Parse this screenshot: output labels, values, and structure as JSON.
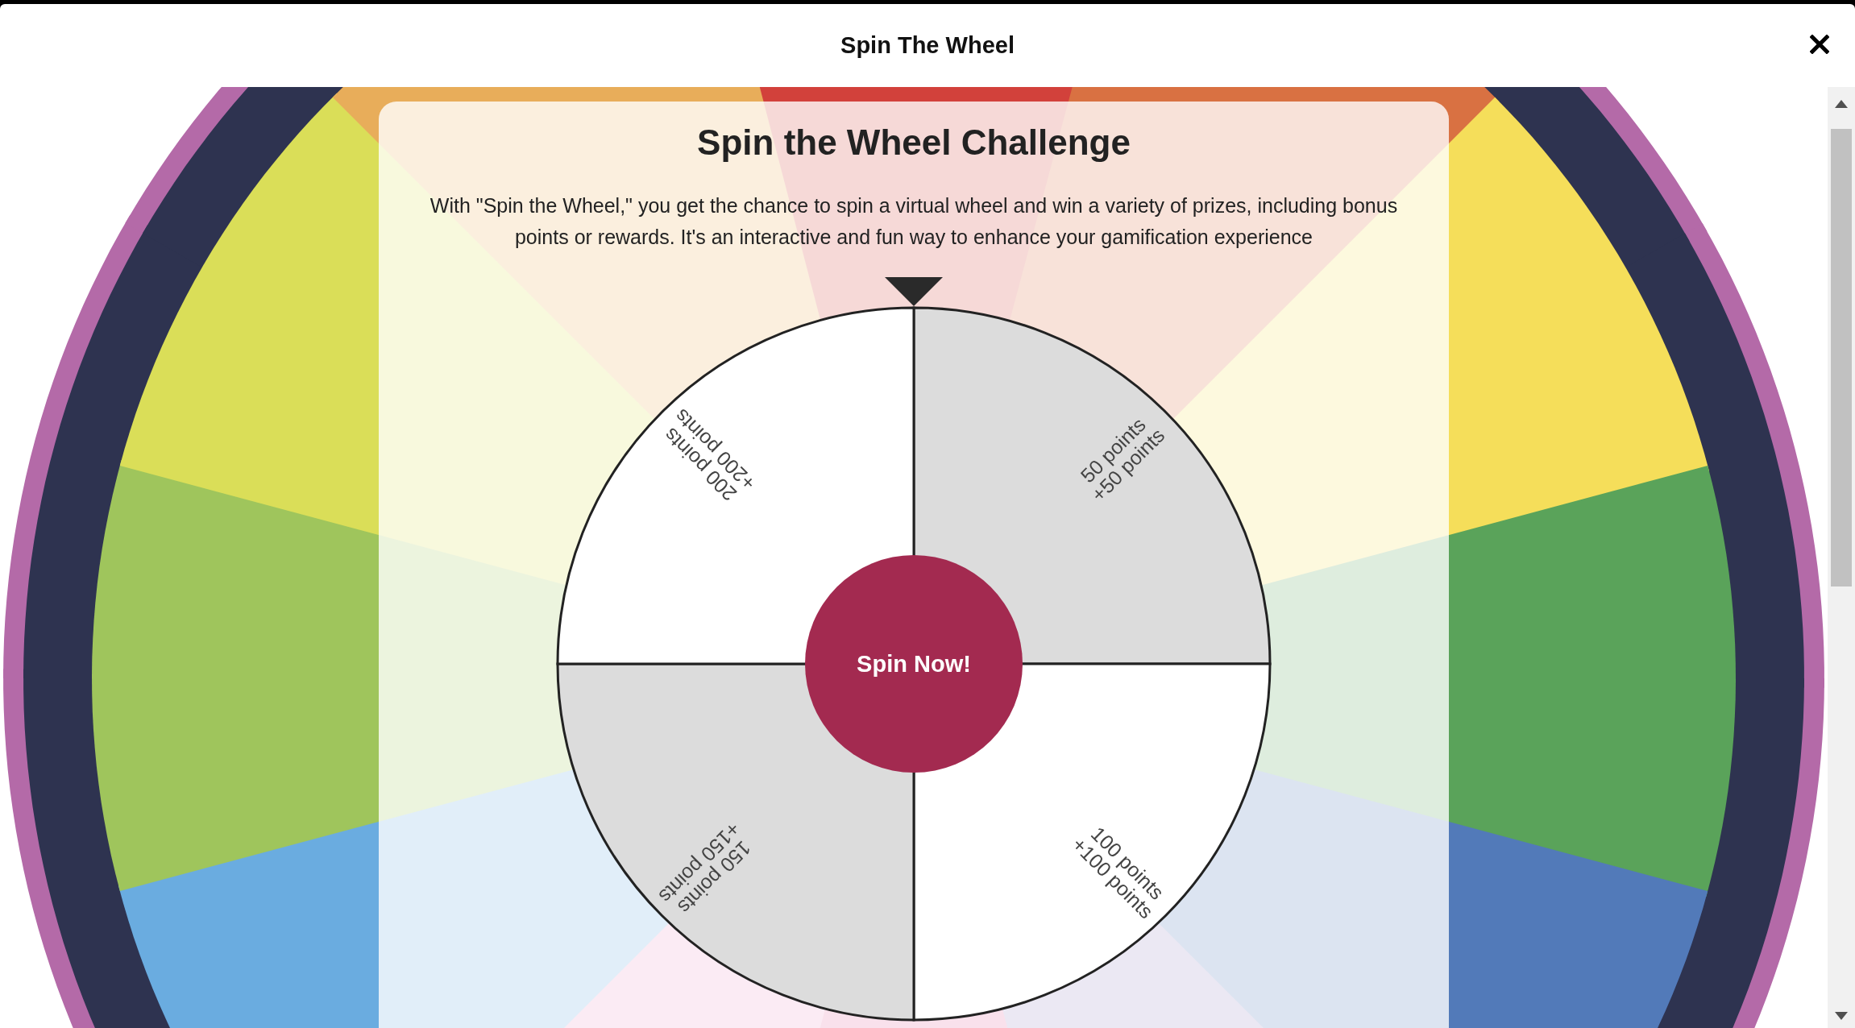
{
  "dialog": {
    "title": "Spin The Wheel"
  },
  "challenge": {
    "title": "Spin the Wheel Challenge",
    "description": "With \"Spin the Wheel,\" you get the chance to spin a virtual wheel and win a variety of prizes, including bonus points or rewards. It's an interactive and fun way to enhance your gamification experience",
    "segments": [
      {
        "prize": "50 points",
        "bonus": "+50 points"
      },
      {
        "prize": "100 points",
        "bonus": "+100 points"
      },
      {
        "prize": "150 points",
        "bonus": "+150 points"
      },
      {
        "prize": "200 points",
        "bonus": "+200 points"
      }
    ],
    "spin_button": "Spin Now!"
  }
}
